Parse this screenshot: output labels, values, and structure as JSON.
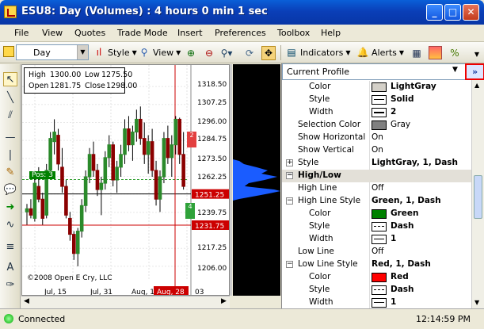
{
  "window": {
    "title": "ESU8: Day (Volumes) : 4 hours 0 min 1 sec"
  },
  "menu": [
    "File",
    "View",
    "Quotes",
    "Trade Mode",
    "Insert",
    "Preferences",
    "Toolbox",
    "Help"
  ],
  "toolbar": {
    "interval": "Day",
    "style": "Style",
    "view": "View",
    "indicators": "Indicators",
    "alerts": "Alerts"
  },
  "ohlc": {
    "high_label": "High",
    "high": "1300.00",
    "low_label": "Low",
    "low": "1275.50",
    "open_label": "Open",
    "open": "1281.75",
    "close_label": "Close",
    "close": "1298.00"
  },
  "chart": {
    "price_ticks": [
      "1318.50",
      "1307.25",
      "1296.00",
      "1284.75",
      "1273.50",
      "1262.25",
      "1251.25",
      "1239.75",
      "1231.75",
      "1217.25",
      "1206.00"
    ],
    "date_ticks": [
      "Jul, 15",
      "Jul, 31",
      "Aug, 18",
      "Aug, 28",
      "03"
    ],
    "pos_label": "Pos: 3",
    "copyright": "©2008 Open E Cry, LLC",
    "marker_2": "2",
    "marker_4": "4"
  },
  "chart_data": {
    "type": "candlestick",
    "note_values": "OHLC visual only",
    "ylim": [
      1200,
      1325
    ],
    "price_ticks": [
      1318.5,
      1307.25,
      1296,
      1284.75,
      1273.5,
      1262.25,
      1251.25,
      1239.75,
      1231.75,
      1217.25,
      1206
    ],
    "highlight_prices": [
      1251.25,
      1231.75
    ],
    "candles": [
      [
        1240,
        1245,
        1232,
        1242
      ],
      [
        1242,
        1248,
        1236,
        1238
      ],
      [
        1236,
        1262,
        1234,
        1258
      ],
      [
        1256,
        1268,
        1246,
        1248
      ],
      [
        1248,
        1252,
        1232,
        1236
      ],
      [
        1238,
        1270,
        1236,
        1266
      ],
      [
        1266,
        1290,
        1262,
        1286
      ],
      [
        1284,
        1298,
        1276,
        1290
      ],
      [
        1288,
        1292,
        1266,
        1270
      ],
      [
        1268,
        1280,
        1252,
        1256
      ],
      [
        1256,
        1260,
        1236,
        1238
      ],
      [
        1236,
        1240,
        1222,
        1226
      ],
      [
        1226,
        1228,
        1210,
        1214
      ],
      [
        1214,
        1230,
        1206,
        1228
      ],
      [
        1228,
        1248,
        1224,
        1244
      ],
      [
        1244,
        1266,
        1240,
        1262
      ],
      [
        1262,
        1280,
        1258,
        1276
      ],
      [
        1276,
        1284,
        1262,
        1266
      ],
      [
        1266,
        1270,
        1250,
        1254
      ],
      [
        1254,
        1262,
        1238,
        1258
      ],
      [
        1258,
        1278,
        1254,
        1274
      ],
      [
        1274,
        1288,
        1268,
        1282
      ],
      [
        1282,
        1284,
        1256,
        1260
      ],
      [
        1260,
        1272,
        1252,
        1268
      ],
      [
        1268,
        1282,
        1262,
        1276
      ],
      [
        1276,
        1298,
        1270,
        1292
      ],
      [
        1292,
        1300,
        1278,
        1282
      ],
      [
        1282,
        1294,
        1272,
        1290
      ],
      [
        1290,
        1304,
        1284,
        1298
      ],
      [
        1298,
        1306,
        1282,
        1286
      ],
      [
        1286,
        1296,
        1270,
        1276
      ],
      [
        1276,
        1288,
        1264,
        1284
      ],
      [
        1284,
        1292,
        1262,
        1266
      ],
      [
        1266,
        1272,
        1244,
        1248
      ],
      [
        1248,
        1266,
        1240,
        1262
      ],
      [
        1262,
        1290,
        1258,
        1286
      ],
      [
        1286,
        1294,
        1270,
        1274
      ],
      [
        1274,
        1288,
        1262,
        1282
      ],
      [
        1282,
        1300,
        1276,
        1298
      ],
      [
        1298,
        1299,
        1270,
        1276
      ],
      [
        1276,
        1290,
        1254,
        1256
      ]
    ]
  },
  "props": {
    "profile": "Current Profile",
    "rows": [
      {
        "label": "Color",
        "value": "LightGray",
        "swatch": "#d4d0c8",
        "kind": "color"
      },
      {
        "label": "Style",
        "value": "Solid",
        "kind": "style"
      },
      {
        "label": "Width",
        "value": "2",
        "kind": "width"
      },
      {
        "label": "Selection Color",
        "value": "Gray",
        "swatch": "#808080",
        "kind": "color2"
      },
      {
        "label": "Show Horizontal",
        "value": "On",
        "kind": "text"
      },
      {
        "label": "Show Vertical",
        "value": "On",
        "kind": "text"
      },
      {
        "label": "Style",
        "value": "LightGray, 1, Dash",
        "kind": "group"
      },
      {
        "label": "High/Low",
        "value": "",
        "kind": "cat"
      },
      {
        "label": "High Line",
        "value": "Off",
        "kind": "text"
      },
      {
        "label": "High Line Style",
        "value": "Green, 1, Dash",
        "kind": "group"
      },
      {
        "label": "Color",
        "value": "Green",
        "swatch": "#008000",
        "kind": "color"
      },
      {
        "label": "Style",
        "value": "Dash",
        "kind": "style"
      },
      {
        "label": "Width",
        "value": "1",
        "kind": "width"
      },
      {
        "label": "Low Line",
        "value": "Off",
        "kind": "text"
      },
      {
        "label": "Low Line Style",
        "value": "Red, 1, Dash",
        "kind": "group"
      },
      {
        "label": "Color",
        "value": "Red",
        "swatch": "#ff0000",
        "kind": "color"
      },
      {
        "label": "Style",
        "value": "Dash",
        "kind": "style"
      },
      {
        "label": "Width",
        "value": "1",
        "kind": "width"
      }
    ]
  },
  "status": {
    "connection": "Connected",
    "time": "12:14:59 PM"
  }
}
